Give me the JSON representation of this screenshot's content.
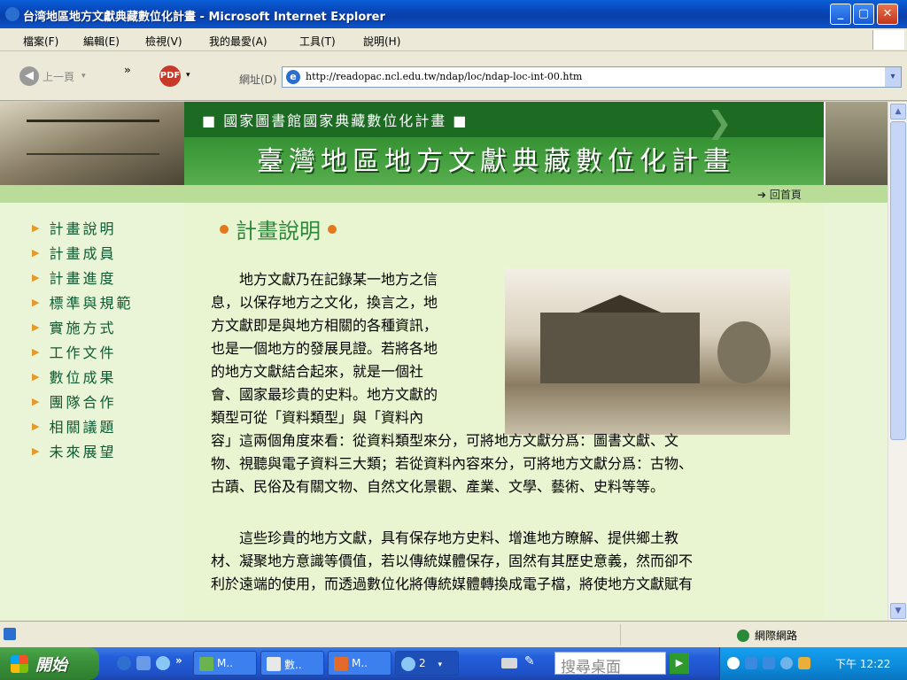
{
  "window": {
    "title": "台湾地區地方文獻典藏數位化計畫 - Microsoft Internet Explorer",
    "btn_min": "_",
    "btn_max": "▢",
    "btn_close": "✕"
  },
  "menu": {
    "items": [
      "檔案(F)",
      "編輯(E)",
      "檢視(V)",
      "我的最愛(A)",
      "工具(T)",
      "說明(H)"
    ]
  },
  "toolbar": {
    "back_label": "上一頁",
    "address_label": "網址(D)",
    "address_value": "http://readopac.ncl.edu.tw/ndap/loc/ndap-loc-int-00.htm"
  },
  "site": {
    "subtitle": "■ 國家圖書館國家典藏數位化計畫 ■",
    "title": "臺灣地區地方文獻典藏數位化計畫",
    "home_link": "➔ 回首頁",
    "nav": [
      "計畫說明",
      "計畫成員",
      "計畫進度",
      "標準與規範",
      "實施方式",
      "工作文件",
      "數位成果",
      "團隊合作",
      "相關議題",
      "未來展望"
    ],
    "heading": "計畫說明",
    "paragraphs": [
      "　　地方文獻乃在記錄某一地方之信",
      "息，以保存地方之文化，換言之，地",
      "方文獻即是與地方相關的各種資訊，",
      "也是一個地方的發展見證。若將各地",
      "的地方文獻結合起來，就是一個社",
      "會、國家最珍貴的史料。地方文獻的",
      "類型可從「資料類型」與「資料內",
      "容」這兩個角度來看：從資料類型來分，可將地方文獻分爲：圖書文獻、文",
      "物、視聽與電子資料三大類；若從資料內容來分，可將地方文獻分爲：古物、",
      "古蹟、民俗及有關文物、自然文化景觀、產業、文學、藝術、史料等等。",
      "",
      "　　這些珍貴的地方文獻，具有保存地方史料、增進地方瞭解、提供鄉土教",
      "材、凝聚地方意識等價值，若以傳統媒體保存，固然有其歷史意義，然而卻不",
      "利於遠端的使用，而透過數位化將傳統媒體轉換成電子檔，將使地方文獻賦有"
    ]
  },
  "status": {
    "zone": "網際網路"
  },
  "taskbar": {
    "start": "開始",
    "tasks": [
      "M..",
      "數..",
      "M..",
      "2"
    ],
    "search_placeholder": "搜尋桌面",
    "clock": "下午 12:22"
  }
}
